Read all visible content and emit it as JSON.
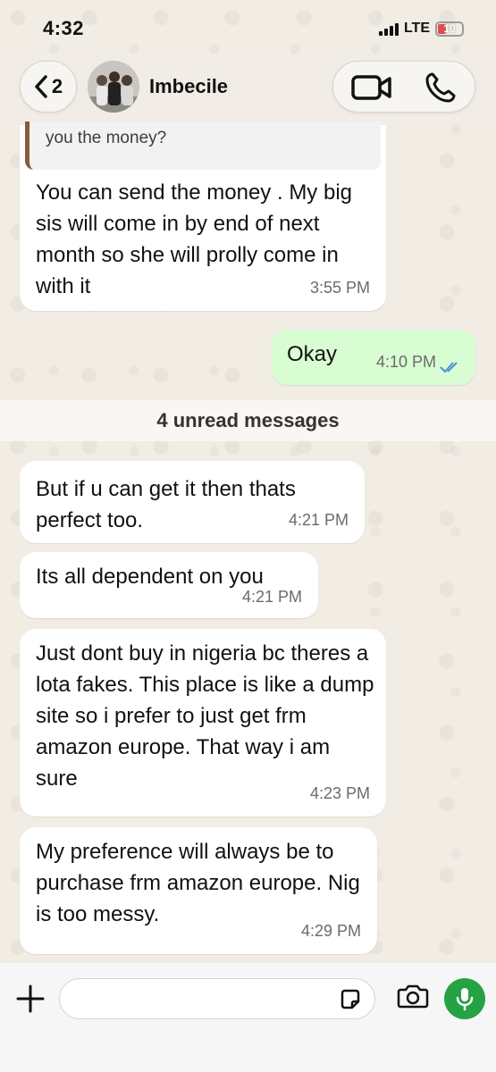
{
  "status_bar": {
    "time": "4:32",
    "network": "LTE",
    "battery": "10"
  },
  "header": {
    "back_count": "2",
    "contact_name": "Imbecile"
  },
  "quoted_message": {
    "text": "you the money?"
  },
  "messages": [
    {
      "direction": "in",
      "text": "You can send the money . My big sis will come in by end of next month so she will prolly come in with it",
      "time": "3:55 PM"
    },
    {
      "direction": "out",
      "text": "Okay",
      "time": "4:10 PM",
      "status": "read"
    },
    {
      "direction": "in",
      "text": "But if u can get it then thats perfect too.",
      "time": "4:21 PM"
    },
    {
      "direction": "in",
      "text": "Its all dependent on you",
      "time": "4:21 PM"
    },
    {
      "direction": "in",
      "text": "Just dont buy in nigeria bc theres a lota fakes. This place is like a dump site so i prefer to just get frm amazon europe. That way i am sure",
      "time": "4:23 PM"
    },
    {
      "direction": "in",
      "text": "My preference will always be to purchase frm amazon europe. Nig is too messy.",
      "time": "4:29 PM"
    }
  ],
  "unread_divider": "4 unread messages",
  "composer": {
    "placeholder": ""
  },
  "colors": {
    "incoming": "#ffffff",
    "outgoing": "#d8fdd2",
    "accent": "#25a244",
    "read_ticks": "#4a90d9"
  },
  "icons": [
    "back-chevron-icon",
    "video-camera-icon",
    "phone-icon",
    "plus-icon",
    "sticker-icon",
    "camera-icon",
    "microphone-icon"
  ]
}
